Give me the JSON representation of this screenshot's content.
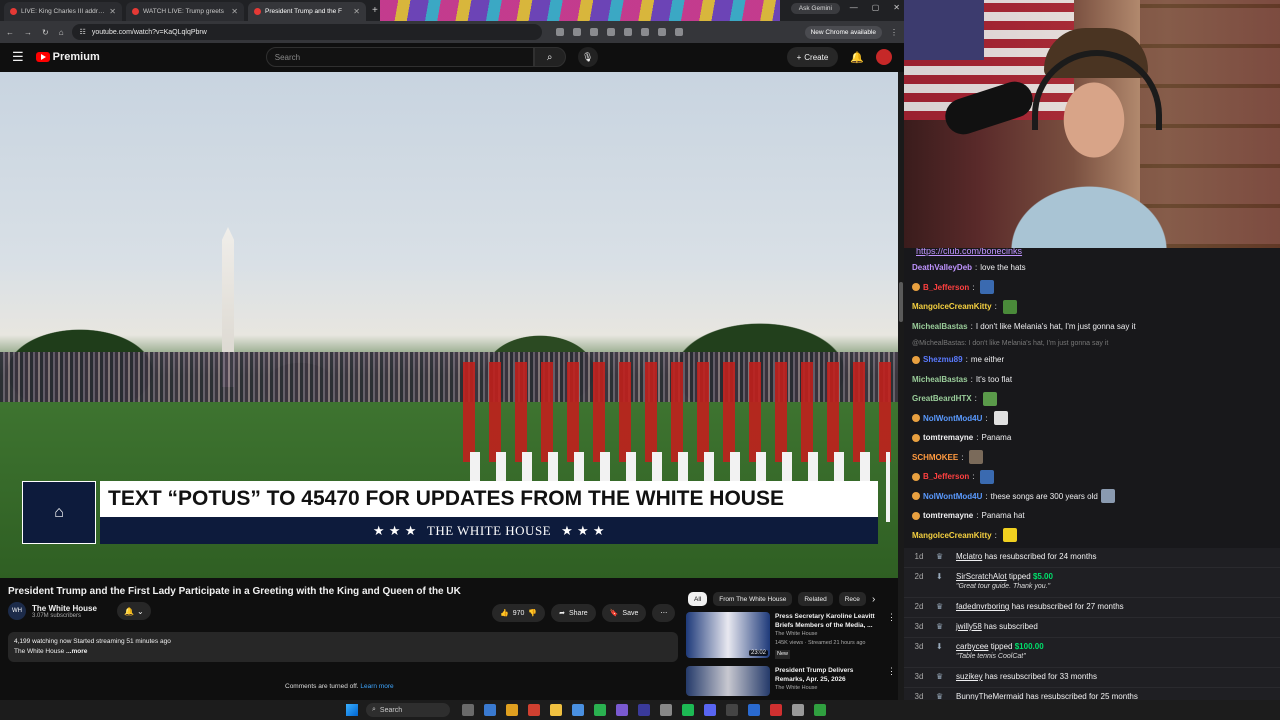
{
  "browser": {
    "tabs": [
      {
        "label": "LIVE: King Charles III addresses"
      },
      {
        "label": "WATCH LIVE: Trump greets"
      },
      {
        "label": "President Trump and the F"
      }
    ],
    "ask_gemini": "Ask Gemini",
    "url": "youtube.com/watch?v=KaQLqlqPbrw",
    "chrome_badge": "New Chrome available"
  },
  "youtube": {
    "logo": "Premium",
    "search_placeholder": "Search",
    "create": "Create",
    "video": {
      "lower_third_text": "TEXT “POTUS” TO 45470 FOR UPDATES FROM THE WHITE HOUSE",
      "lower_third_brand": "THE WHITE HOUSE",
      "stars": "★ ★ ★"
    },
    "title": "President Trump and the First Lady Participate in a Greeting with the King and Queen of the UK",
    "channel": {
      "name": "The White House",
      "subs": "3.07M subscribers"
    },
    "likes": "970",
    "share": "Share",
    "save": "Save",
    "desc_stats": "4,199 watching now  Started streaming 51 minutes ago",
    "desc_text": "The White House",
    "desc_more": "...more",
    "comments_off": "Comments are turned off.",
    "learn_more": "Learn more",
    "chips": [
      "All",
      "From The White House",
      "Related",
      "Rece"
    ],
    "recommendations": [
      {
        "title": "Press Secretary Karoline Leavitt Briefs Members of the Media, ...",
        "channel": "The White House",
        "meta": "145K views · Streamed 21 hours ago",
        "duration": "23:02",
        "badge": "New"
      },
      {
        "title": "President Trump Delivers Remarks, Apr. 25, 2026",
        "channel": "The White House",
        "meta": "",
        "duration": "",
        "badge": ""
      }
    ]
  },
  "chat": {
    "pinned": "https://club.com/bonecinks",
    "messages": [
      {
        "user": "DeathValleyDeb",
        "color": "#bf94ff",
        "text": "love the hats",
        "badge": false,
        "emote": ""
      },
      {
        "user": "B_Jefferson",
        "color": "#ff4040",
        "text": "",
        "badge": true,
        "emote": "#3a6ab0"
      },
      {
        "user": "MangoIceCreamKitty",
        "color": "#f5d040",
        "text": "",
        "badge": false,
        "emote": "#4a8a3a"
      },
      {
        "user": "MichealBastas",
        "color": "#9acd9a",
        "text": "I don't like Melania's hat, I'm just gonna say it",
        "badge": false,
        "emote": ""
      },
      {
        "reply": "@MichealBastas: I don't like Melania's hat, I'm just gonna say it"
      },
      {
        "user": "Shezmu89",
        "color": "#5a7aff",
        "text": "me either",
        "badge": true,
        "emote": ""
      },
      {
        "user": "MichealBastas",
        "color": "#9acd9a",
        "text": "It's too flat",
        "badge": false,
        "emote": ""
      },
      {
        "user": "GreatBeardHTX",
        "color": "#9acd9a",
        "text": "",
        "badge": false,
        "emote": "#5a9a4a"
      },
      {
        "user": "NolWontMod4U",
        "color": "#5a9aff",
        "text": "",
        "badge": true,
        "emote": "#e0e0e0"
      },
      {
        "user": "tomtremayne",
        "color": "#efeff1",
        "text": "Panama",
        "badge": true,
        "emote": ""
      },
      {
        "user": "SCHMOKEE",
        "color": "#ff9a40",
        "text": "",
        "badge": false,
        "emote": "#7a6a5a"
      },
      {
        "user": "B_Jefferson",
        "color": "#ff4040",
        "text": "",
        "badge": true,
        "emote": "#3a6ab0"
      },
      {
        "user": "NolWontMod4U",
        "color": "#5a9aff",
        "text": "these songs are 300 years old",
        "badge": true,
        "emote": "#8a9ab0"
      },
      {
        "user": "tomtremayne",
        "color": "#efeff1",
        "text": "Panama hat",
        "badge": true,
        "emote": ""
      },
      {
        "user": "MangoIceCreamKitty",
        "color": "#f5d040",
        "text": "",
        "badge": false,
        "emote": "#f0d020"
      }
    ]
  },
  "events": [
    {
      "age": "1d",
      "name": "Mclatro",
      "text": " has resubscribed for 24 months",
      "money": "",
      "quote": ""
    },
    {
      "age": "2d",
      "name": "SirScratchAlot",
      "text": " tipped ",
      "money": "$5.00",
      "quote": "\"Great tour guide. Thank you.\""
    },
    {
      "age": "2d",
      "name": "fadednvrboring",
      "text": " has resubscribed for 27 months",
      "money": "",
      "quote": ""
    },
    {
      "age": "3d",
      "name": "jwilly58",
      "text": " has subscribed",
      "money": "",
      "quote": ""
    },
    {
      "age": "3d",
      "name": "carbycee",
      "text": " tipped ",
      "money": "$100.00",
      "quote": "\"Table tennis CoolCat\""
    },
    {
      "age": "3d",
      "name": "suzikey",
      "text": " has resubscribed for 33 months",
      "money": "",
      "quote": ""
    },
    {
      "age": "3d",
      "name": "BunnyTheMermaid",
      "text": " has resubscribed for 25 months",
      "money": "",
      "quote": ""
    }
  ],
  "taskbar": {
    "search": "Search"
  }
}
